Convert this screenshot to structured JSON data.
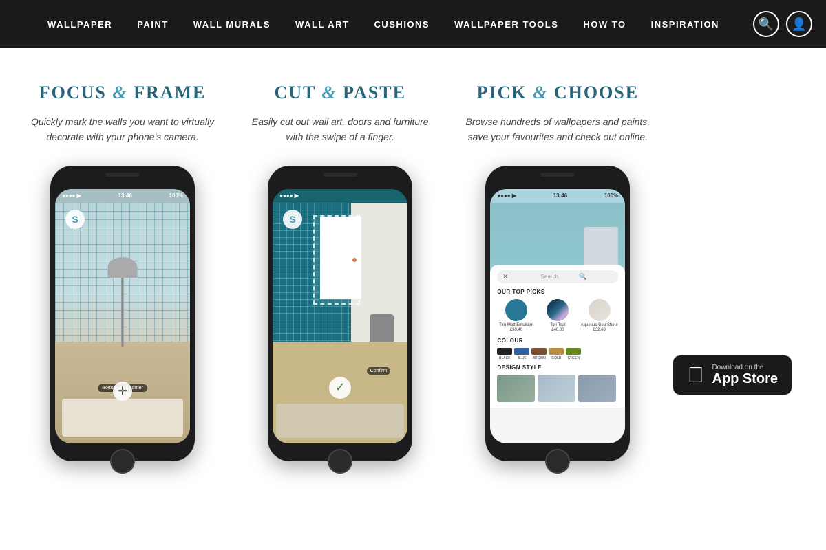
{
  "nav": {
    "items": [
      {
        "label": "WALLPAPER"
      },
      {
        "label": "PAINT"
      },
      {
        "label": "WALL MURALS"
      },
      {
        "label": "WALL ART"
      },
      {
        "label": "CUSHIONS"
      },
      {
        "label": "WALLPAPER TOOLS"
      },
      {
        "label": "HOW TO"
      },
      {
        "label": "INSPIRATION"
      }
    ]
  },
  "features": [
    {
      "title_part1": "FOCUS",
      "title_amp": "&",
      "title_part2": "FRAME",
      "description": "Quickly mark the walls you want to virtually decorate with your phone's camera."
    },
    {
      "title_part1": "CUT",
      "title_amp": "&",
      "title_part2": "PASTE",
      "description": "Easily cut out wall art, doors and furniture with the swipe of a finger."
    },
    {
      "title_part1": "PICK",
      "title_amp": "&",
      "title_part2": "CHOOSE",
      "description": "Browse hundreds of wallpapers and paints, save your favourites and check out online."
    }
  ],
  "phone1": {
    "status_left": "●●●● ▶",
    "status_time": "13:46",
    "status_right": "100%",
    "corner_label": "Bottom right corner"
  },
  "phone2": {
    "status_left": "●●●● ▶",
    "confirm_label": "Confirm"
  },
  "phone3": {
    "search_placeholder": "Search",
    "top_picks_label": "OUR TOP PICKS",
    "colour_label": "COLOUR",
    "design_label": "DESIGN STYLE",
    "products": [
      {
        "name": "Tiru Matt Emulsion",
        "price": "£30.40",
        "color": "#2a7898"
      },
      {
        "name": "Tori Teal",
        "price": "£40.00",
        "color": "#2a5878"
      },
      {
        "name": "Aqueous Geo Stone",
        "price": "£32.00",
        "color": "#d8d4cc"
      }
    ],
    "colours": [
      {
        "label": "BLACK",
        "hex": "#222222"
      },
      {
        "label": "BLUE",
        "hex": "#3060a0"
      },
      {
        "label": "BROWN",
        "hex": "#7a5030"
      },
      {
        "label": "GOLD",
        "hex": "#b89040"
      },
      {
        "label": "GREEN",
        "hex": "#6a8820"
      }
    ]
  },
  "appstore": {
    "line1": "Download on the",
    "line2": "App Store"
  }
}
